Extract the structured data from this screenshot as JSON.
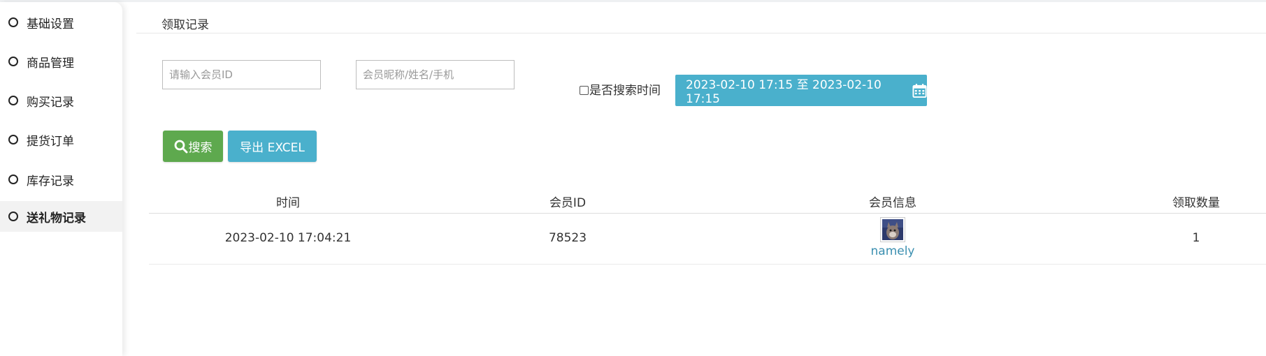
{
  "sidebar": {
    "items": [
      {
        "label": "基础设置",
        "active": false
      },
      {
        "label": "商品管理",
        "active": false
      },
      {
        "label": "购买记录",
        "active": false
      },
      {
        "label": "提货订单",
        "active": false
      },
      {
        "label": "库存记录",
        "active": false
      },
      {
        "label": "送礼物记录",
        "active": true
      }
    ]
  },
  "header": {
    "title": "领取记录"
  },
  "filters": {
    "member_id_placeholder": "请输入会员ID",
    "member_id_value": "",
    "name_placeholder": "会员昵称/姓名/手机",
    "name_value": "",
    "time_checkbox_label": "是否搜索时间",
    "time_checkbox_checked": false,
    "date_range": "2023-02-10 17:15 至 2023-02-10 17:15",
    "date_icon": "calendar-icon"
  },
  "actions": {
    "search_label": "搜索",
    "search_icon": "search-icon",
    "export_label": "导出 EXCEL"
  },
  "table": {
    "columns": [
      "时间",
      "会员ID",
      "会员信息",
      "领取数量"
    ],
    "rows": [
      {
        "time": "2023-02-10 17:04:21",
        "member_id": "78523",
        "nickname": "namely",
        "quantity": "1"
      }
    ]
  },
  "colors": {
    "search_button": "#5ea94e",
    "info_button": "#4ab0cc",
    "link": "#3b8fb0"
  }
}
